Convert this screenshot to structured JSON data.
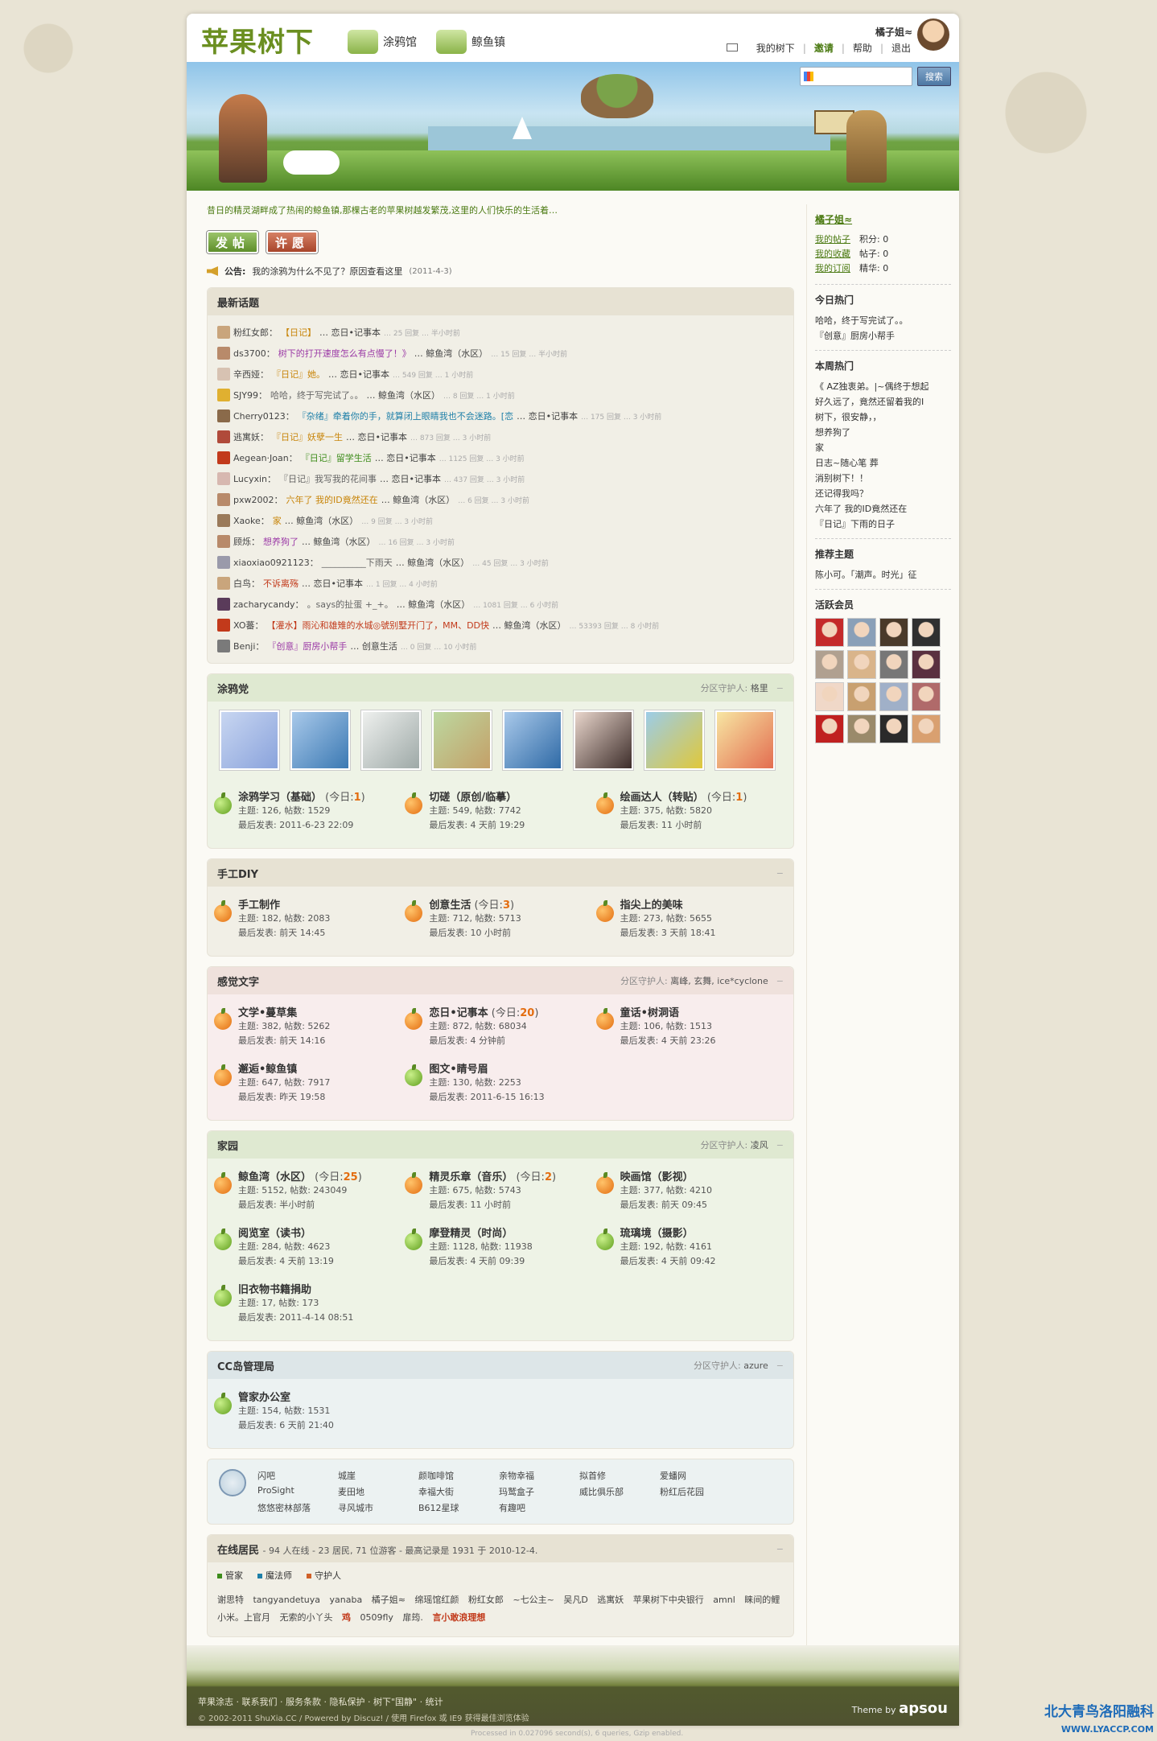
{
  "header": {
    "logo": "苹果树下",
    "nav": [
      {
        "label": "涂鸦馆"
      },
      {
        "label": "鲸鱼镇"
      }
    ],
    "username": "橘子姐≈",
    "links": [
      "我的树下",
      "邀请",
      "帮助",
      "退出"
    ],
    "search_button": "搜索"
  },
  "intro": "昔日的精灵湖畔成了热闹的鲸鱼镇,那棵古老的苹果树越发繁茂,这里的人们快乐的生活着…",
  "buttons": {
    "post": "发帖",
    "wish": "许愿"
  },
  "announcement": {
    "label": "公告:",
    "text": "我的涂鸦为什么不见了？原因查看这里",
    "date": "(2011-4-3)"
  },
  "latest": {
    "title": "最新话题",
    "items": [
      {
        "user": "粉红女郎：",
        "title": "【日记】",
        "forum": "… 恋日•记事本",
        "meta": "… 25 回复 … 半小时前"
      },
      {
        "user": "ds3700：",
        "title": "树下的打开速度怎么有点慢了！》",
        "forum": "… 鲸鱼湾（水区）",
        "meta": "… 15 回复 … 半小时前"
      },
      {
        "user": "辛西娅：",
        "title": "『日记』她。",
        "forum": "… 恋日•记事本",
        "meta": "… 549 回复 … 1 小时前"
      },
      {
        "user": "SJY99：",
        "title": "哈哈，终于写完试了。。",
        "forum": "… 鲸鱼湾（水区）",
        "meta": "… 8 回复 … 1 小时前"
      },
      {
        "user": "Cherry0123：",
        "title": "『杂绪』牵着你的手，就算闭上眼睛我也不会迷路。[恋",
        "forum": "… 恋日•记事本",
        "meta": "… 175 回复 … 3 小时前"
      },
      {
        "user": "逃寓妖：",
        "title": "『日记』妖孽一生",
        "forum": "… 恋日•记事本",
        "meta": "… 873 回复 … 3 小时前"
      },
      {
        "user": "Aegean·Joan：",
        "title": "『日记』留学生活",
        "forum": "… 恋日•记事本",
        "meta": "… 1125 回复 … 3 小时前"
      },
      {
        "user": "Lucyxin：",
        "title": "『日记』我写我的花间事",
        "forum": "… 恋日•记事本",
        "meta": "… 437 回复 … 3 小时前"
      },
      {
        "user": "pxw2002：",
        "title": "六年了 我的ID竟然还在",
        "forum": "… 鲸鱼湾（水区）",
        "meta": "… 6 回复 … 3 小时前"
      },
      {
        "user": "Xaoke：",
        "title": "家",
        "forum": "… 鲸鱼湾（水区）",
        "meta": "… 9 回复 … 3 小时前"
      },
      {
        "user": "顾烁：",
        "title": "想养狗了",
        "forum": "… 鲸鱼湾（水区）",
        "meta": "… 16 回复 … 3 小时前"
      },
      {
        "user": "xiaoxiao0921123：",
        "title": "__________下雨天",
        "forum": "… 鲸鱼湾（水区）",
        "meta": "… 45 回复 … 3 小时前"
      },
      {
        "user": "白鸟：",
        "title": "不诉离殇",
        "forum": "… 恋日•记事本",
        "meta": "… 1 回复 … 4 小时前"
      },
      {
        "user": "zacharycandy：",
        "title": "。says的扯蛋 +_+。",
        "forum": "… 鲸鱼湾（水区）",
        "meta": "… 1081 回复 … 6 小时前"
      },
      {
        "user": "XO蕃：",
        "title": "【灌水】雨沁和雄雉的水城◎號别墅开门了，MM、DD快",
        "forum": "… 鲸鱼湾（水区）",
        "meta": "… 53393 回复 … 8 小时前"
      },
      {
        "user": "Benji：",
        "title": "『创意』厨房小帮手",
        "forum": "… 创意生活",
        "meta": "… 0 回复 … 10 小时前"
      }
    ]
  },
  "sections": [
    {
      "title": "涂鸦党",
      "moderators_label": "分区守护人:",
      "moderators": "格里",
      "forums": [
        {
          "name": "涂鸦学习（基础）",
          "today": "1",
          "today_label": "(今日:",
          "stats": "主题: 126, 帖数: 1529",
          "last": "最后发表: 2011-6-23 22:09"
        },
        {
          "name": "切磋（原创/临摹）",
          "today": "",
          "today_label": "",
          "stats": "主题: 549, 帖数: 7742",
          "last": "最后发表: 4 天前 19:29"
        },
        {
          "name": "绘画达人（转贴）",
          "today": "1",
          "today_label": "(今日:",
          "stats": "主题: 375, 帖数: 5820",
          "last": "最后发表: 11 小时前"
        }
      ]
    },
    {
      "title": "手工DIY",
      "moderators_label": "",
      "moderators": "",
      "forums": [
        {
          "name": "手工制作",
          "today": "",
          "today_label": "",
          "stats": "主题: 182, 帖数: 2083",
          "last": "最后发表: 前天 14:45"
        },
        {
          "name": "创意生活",
          "today": "3",
          "today_label": "(今日:",
          "stats": "主题: 712, 帖数: 5713",
          "last": "最后发表: 10 小时前"
        },
        {
          "name": "指尖上的美味",
          "today": "",
          "today_label": "",
          "stats": "主题: 273, 帖数: 5655",
          "last": "最后发表: 3 天前 18:41"
        }
      ]
    },
    {
      "title": "感觉文字",
      "moderators_label": "分区守护人:",
      "moderators": "离峰, 玄舞, ice*cyclone",
      "forums": [
        {
          "name": "文学•蔓草集",
          "today": "",
          "today_label": "",
          "stats": "主题: 382, 帖数: 5262",
          "last": "最后发表: 前天 14:16"
        },
        {
          "name": "恋日•记事本",
          "today": "20",
          "today_label": "(今日:",
          "stats": "主题: 872, 帖数: 68034",
          "last": "最后发表: 4 分钟前"
        },
        {
          "name": "童话•树洞语",
          "today": "",
          "today_label": "",
          "stats": "主题: 106, 帖数: 1513",
          "last": "最后发表: 4 天前 23:26"
        },
        {
          "name": "邂逅•鲸鱼镇",
          "today": "",
          "today_label": "",
          "stats": "主题: 647, 帖数: 7917",
          "last": "最后发表: 昨天 19:58"
        },
        {
          "name": "图文•睛号眉",
          "today": "",
          "today_label": "",
          "stats": "主题: 130, 帖数: 2253",
          "last": "最后发表: 2011-6-15 16:13"
        }
      ]
    },
    {
      "title": "家园",
      "moderators_label": "分区守护人:",
      "moderators": "凌风",
      "forums": [
        {
          "name": "鲸鱼湾（水区）",
          "today": "25",
          "today_label": "(今日:",
          "stats": "主题: 5152, 帖数: 243049",
          "last": "最后发表: 半小时前"
        },
        {
          "name": "精灵乐章（音乐）",
          "today": "2",
          "today_label": "(今日:",
          "stats": "主题: 675, 帖数: 5743",
          "last": "最后发表: 11 小时前"
        },
        {
          "name": "映画馆（影视）",
          "today": "",
          "today_label": "",
          "stats": "主题: 377, 帖数: 4210",
          "last": "最后发表: 前天 09:45"
        },
        {
          "name": "阅览室（读书）",
          "today": "",
          "today_label": "",
          "stats": "主题: 284, 帖数: 4623",
          "last": "最后发表: 4 天前 13:19"
        },
        {
          "name": "摩登精灵（时尚）",
          "today": "",
          "today_label": "",
          "stats": "主题: 1128, 帖数: 11938",
          "last": "最后发表: 4 天前 09:39"
        },
        {
          "name": "琉璃境（摄影）",
          "today": "",
          "today_label": "",
          "stats": "主题: 192, 帖数: 4161",
          "last": "最后发表: 4 天前 09:42"
        },
        {
          "name": "旧衣物书籍捐助",
          "today": "",
          "today_label": "",
          "stats": "主题: 17, 帖数: 173",
          "last": "最后发表: 2011-4-14 08:51"
        }
      ]
    },
    {
      "title": "CC岛管理局",
      "moderators_label": "分区守护人:",
      "moderators": "azure",
      "forums": [
        {
          "name": "管家办公室",
          "today": "",
          "today_label": "",
          "stats": "主题: 154, 帖数: 1531",
          "last": "最后发表: 6 天前 21:40"
        }
      ]
    }
  ],
  "friend_links": [
    "闪吧",
    "城崖",
    "颜咖啡馆",
    "亲物幸福",
    "拟首修",
    "爱蟠网",
    "ProSight",
    "麦田地",
    "幸福大街",
    "玛鹫盒子",
    "威比俱乐部",
    "粉红后花园",
    "悠悠密林部落",
    "寻风城市",
    "B612星球",
    "有趣吧"
  ],
  "online": {
    "title": "在线居民",
    "summary": "- 94 人在线 - 23 居民, 71 位游客 - 最高记录是 1931 于 2010-12-4.",
    "legend": [
      "管家",
      "魔法师",
      "守护人"
    ],
    "names": "谢思特  tangyandetuya  yanaba  橘子姐≈  绵瑶馆红颜  粉红女郎  ~七公主~  吴凡D  逃寓妖  苹果树下中央银行  amnl  睐间的鲤  小米。上官月  无索的小丫头",
    "names_red1": "鸡",
    "names2": "0509fly  扉筠.",
    "names_red2": "言小敢浪理想"
  },
  "sidebar": {
    "user": "橘子姐≈",
    "my_links": [
      "我的帖子",
      "我的收藏",
      "我的订阅"
    ],
    "stats": [
      "积分: 0",
      "帖子: 0",
      "精华: 0"
    ],
    "today_hot_title": "今日热门",
    "today_hot": [
      "哈哈，终于写完试了。。",
      "『创意』厨房小帮手"
    ],
    "week_hot_title": "本周热门",
    "week_hot": [
      "《 AZ独衷弟。|~偶终于想起",
      "好久远了，竟然还留着我的I",
      "树下，很安静，，",
      "想养狗了",
      "家",
      "日志~随心笔 葬",
      "消别树下！！",
      "还记得我吗？",
      "六年了 我的ID竟然还在",
      "『日记』下雨的日子"
    ],
    "rec_title": "推荐主题",
    "rec": "陈小可。「潮声。时光」征",
    "active_title": "活跃会员"
  },
  "footer": {
    "links": "苹果涂志 · 联系我们 · 服务条款 · 隐私保护 · 树下\"国静\" · 统计",
    "copyright": "© 2002-2011 ShuXia.CC  /  Powered by Discuz!  /  使用 Firefox 或 IE9 获得最佳浏览体验",
    "theme": "Theme by",
    "brand": "apsou",
    "processed": "Processed in 0.027096 second(s), 6 queries, Gzip enabled."
  },
  "watermark": {
    "line1": "北大青鸟洛阳融科",
    "line2": "WWW.LYACCP.COM"
  },
  "colors": {
    "accent": "#4b7a12",
    "orange": "#e36d10"
  }
}
